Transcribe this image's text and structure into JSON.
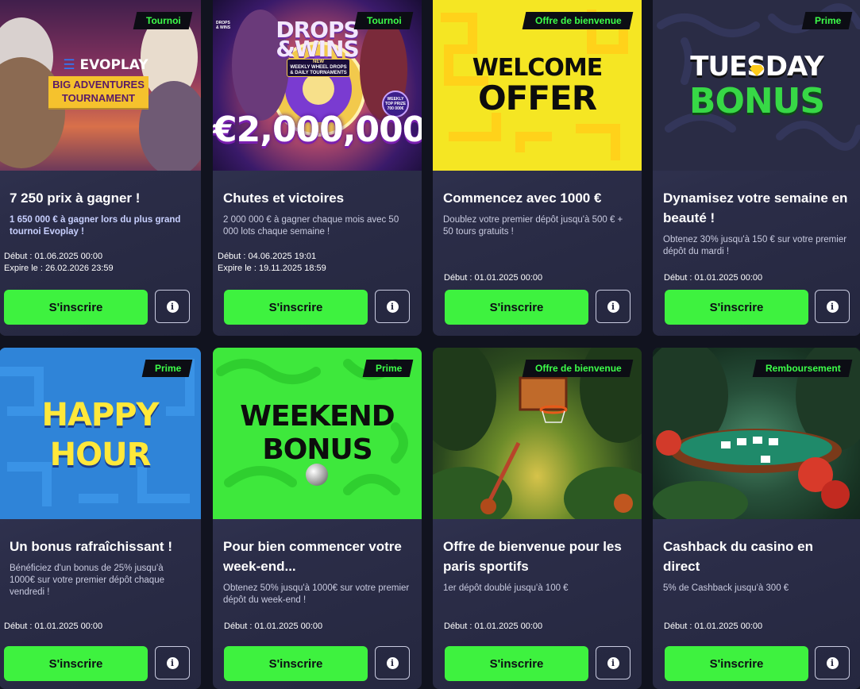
{
  "ui": {
    "signup_label": "S'inscrire",
    "info_icon": "info-icon"
  },
  "cards": [
    {
      "tag": "Tournoi",
      "banner": {
        "brand": "EVOPLAY",
        "line1": "BIG ADVENTURES",
        "line2": "TOURNAMENT"
      },
      "title": "7 250 prix à gagner !",
      "desc": "1 650 000 € à gagner lors du plus grand tournoi Evoplay !",
      "start": "Début : 01.06.2025 00:00",
      "expire": "Expire le : 26.02.2026 23:59"
    },
    {
      "tag": "Tournoi",
      "banner": {
        "corner_badge": "DROPS & WINS",
        "line1": "DROPS",
        "line2": "&WINS",
        "sub1": "NEW",
        "sub2": "WEEKLY WHEEL DROPS",
        "sub3": "& DAILY TOURNAMENTS",
        "badge": "WEEKLY TOP PRIZE 700 000€",
        "amount": "€2,000,000"
      },
      "title": "Chutes et victoires",
      "desc": "2 000 000 € à gagner chaque mois avec 50 000 lots chaque semaine !",
      "start": "Début : 04.06.2025 19:01",
      "expire": "Expire le : 19.11.2025 18:59"
    },
    {
      "tag": "Offre de bienvenue",
      "banner": {
        "line1": "WELCOME",
        "line2": "OFFER"
      },
      "title": "Commencez avec 1000 €",
      "desc": "Doublez votre premier dépôt jusqu'à 500 € + 50 tours gratuits !",
      "start": "Début : 01.01.2025 00:00"
    },
    {
      "tag": "Prime",
      "banner": {
        "line1": "TUESDAY",
        "line2": "BONUS"
      },
      "title": "Dynamisez votre semaine en beauté !",
      "desc": "Obtenez 30% jusqu'à 150 € sur votre premier dépôt du mardi !",
      "start": "Début : 01.01.2025 00:00"
    },
    {
      "tag": "Prime",
      "banner": {
        "line1": "HAPPY",
        "line2": "HOUR"
      },
      "title": "Un bonus rafraîchissant !",
      "desc": "Bénéficiez d'un bonus de 25% jusqu'à 1000€ sur votre premier dépôt chaque vendredi !",
      "start": "Début : 01.01.2025 00:00"
    },
    {
      "tag": "Prime",
      "banner": {
        "line1": "WEEKEND",
        "line2": "BONUS"
      },
      "title": "Pour bien commencer votre week-end...",
      "desc": "Obtenez 50% jusqu'à 1000€ sur votre premier dépôt du week-end !",
      "start": "Début : 01.01.2025 00:00"
    },
    {
      "tag": "Offre de bienvenue",
      "title": "Offre de bienvenue pour les paris sportifs",
      "desc": "1er dépôt doublé jusqu'à 100 €",
      "start": "Début : 01.01.2025 00:00"
    },
    {
      "tag": "Remboursement",
      "title": "Cashback du casino en direct",
      "desc": "5% de Cashback jusqu'à 300 €",
      "start": "Début : 01.01.2025 00:00"
    }
  ]
}
